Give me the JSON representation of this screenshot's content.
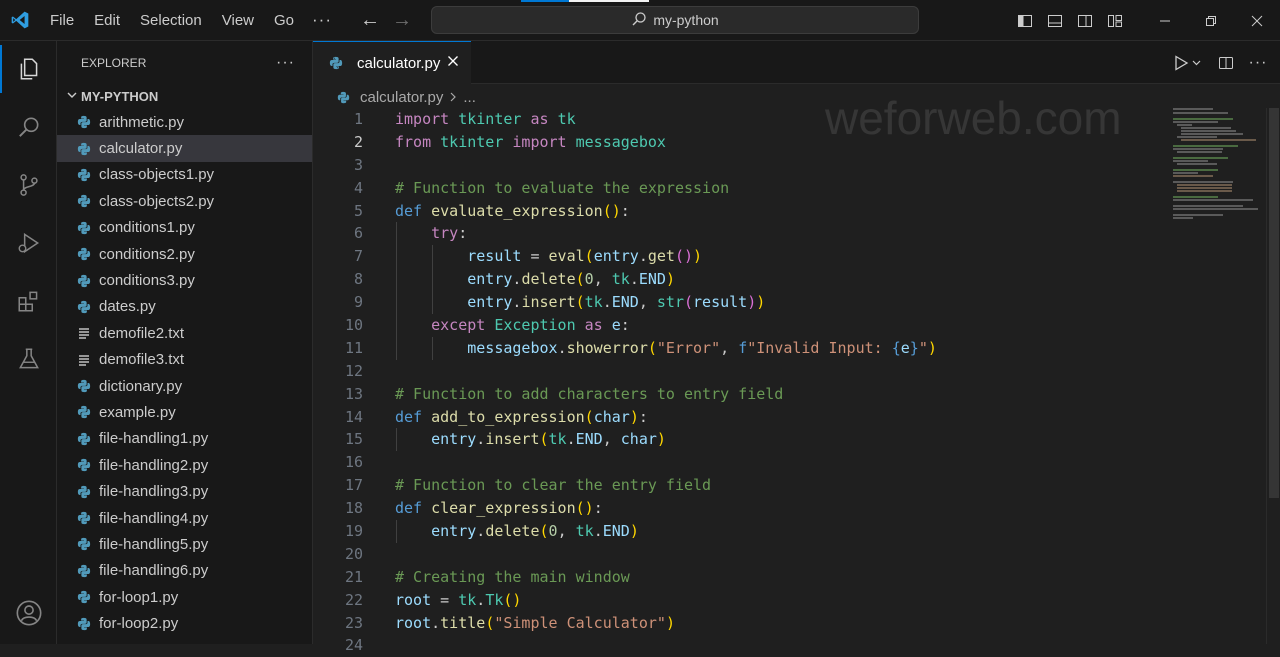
{
  "menu": [
    "File",
    "Edit",
    "Selection",
    "View",
    "Go"
  ],
  "command_center": "my-python",
  "explorer": {
    "title": "EXPLORER",
    "folder": "MY-PYTHON",
    "files": [
      {
        "name": "arithmetic.py",
        "type": "py"
      },
      {
        "name": "calculator.py",
        "type": "py",
        "selected": true
      },
      {
        "name": "class-objects1.py",
        "type": "py"
      },
      {
        "name": "class-objects2.py",
        "type": "py"
      },
      {
        "name": "conditions1.py",
        "type": "py"
      },
      {
        "name": "conditions2.py",
        "type": "py"
      },
      {
        "name": "conditions3.py",
        "type": "py"
      },
      {
        "name": "dates.py",
        "type": "py"
      },
      {
        "name": "demofile2.txt",
        "type": "txt"
      },
      {
        "name": "demofile3.txt",
        "type": "txt"
      },
      {
        "name": "dictionary.py",
        "type": "py"
      },
      {
        "name": "example.py",
        "type": "py"
      },
      {
        "name": "file-handling1.py",
        "type": "py"
      },
      {
        "name": "file-handling2.py",
        "type": "py"
      },
      {
        "name": "file-handling3.py",
        "type": "py"
      },
      {
        "name": "file-handling4.py",
        "type": "py"
      },
      {
        "name": "file-handling5.py",
        "type": "py"
      },
      {
        "name": "file-handling6.py",
        "type": "py"
      },
      {
        "name": "for-loop1.py",
        "type": "py"
      },
      {
        "name": "for-loop2.py",
        "type": "py"
      }
    ]
  },
  "editor": {
    "tab_label": "calculator.py",
    "breadcrumb_file": "calculator.py",
    "breadcrumb_more": "...",
    "watermark": "weforweb.com",
    "lines": [
      [
        [
          "kw",
          "import"
        ],
        [
          "t",
          " "
        ],
        [
          "cls",
          "tkinter"
        ],
        [
          "t",
          " "
        ],
        [
          "kw",
          "as"
        ],
        [
          "t",
          " "
        ],
        [
          "cls",
          "tk"
        ]
      ],
      [
        [
          "kw",
          "from"
        ],
        [
          "t",
          " "
        ],
        [
          "cls",
          "tkinter"
        ],
        [
          "t",
          " "
        ],
        [
          "kw",
          "import"
        ],
        [
          "t",
          " "
        ],
        [
          "cls",
          "messagebox"
        ]
      ],
      [],
      [
        [
          "com",
          "# Function to evaluate the expression"
        ]
      ],
      [
        [
          "kw2",
          "def"
        ],
        [
          "t",
          " "
        ],
        [
          "fn",
          "evaluate_expression"
        ],
        [
          "b1",
          "()"
        ],
        [
          "t",
          ":"
        ]
      ],
      [
        [
          "t",
          "    "
        ],
        [
          "kw",
          "try"
        ],
        [
          "t",
          ":"
        ]
      ],
      [
        [
          "t",
          "        "
        ],
        [
          "var",
          "result"
        ],
        [
          "t",
          " = "
        ],
        [
          "fn",
          "eval"
        ],
        [
          "b1",
          "("
        ],
        [
          "var",
          "entry"
        ],
        [
          "t",
          "."
        ],
        [
          "fn",
          "get"
        ],
        [
          "b2",
          "()"
        ],
        [
          "b1",
          ")"
        ]
      ],
      [
        [
          "t",
          "        "
        ],
        [
          "var",
          "entry"
        ],
        [
          "t",
          "."
        ],
        [
          "fn",
          "delete"
        ],
        [
          "b1",
          "("
        ],
        [
          "num",
          "0"
        ],
        [
          "t",
          ", "
        ],
        [
          "cls",
          "tk"
        ],
        [
          "t",
          "."
        ],
        [
          "var",
          "END"
        ],
        [
          "b1",
          ")"
        ]
      ],
      [
        [
          "t",
          "        "
        ],
        [
          "var",
          "entry"
        ],
        [
          "t",
          "."
        ],
        [
          "fn",
          "insert"
        ],
        [
          "b1",
          "("
        ],
        [
          "cls",
          "tk"
        ],
        [
          "t",
          "."
        ],
        [
          "var",
          "END"
        ],
        [
          "t",
          ", "
        ],
        [
          "cls",
          "str"
        ],
        [
          "b2",
          "("
        ],
        [
          "var",
          "result"
        ],
        [
          "b2",
          ")"
        ],
        [
          "b1",
          ")"
        ]
      ],
      [
        [
          "t",
          "    "
        ],
        [
          "kw",
          "except"
        ],
        [
          "t",
          " "
        ],
        [
          "cls",
          "Exception"
        ],
        [
          "t",
          " "
        ],
        [
          "kw",
          "as"
        ],
        [
          "t",
          " "
        ],
        [
          "var",
          "e"
        ],
        [
          "t",
          ":"
        ]
      ],
      [
        [
          "t",
          "        "
        ],
        [
          "var",
          "messagebox"
        ],
        [
          "t",
          "."
        ],
        [
          "fn",
          "showerror"
        ],
        [
          "b1",
          "("
        ],
        [
          "str",
          "\"Error\""
        ],
        [
          "t",
          ", "
        ],
        [
          "kw2",
          "f"
        ],
        [
          "str",
          "\"Invalid Input: "
        ],
        [
          "kw2",
          "{"
        ],
        [
          "var",
          "e"
        ],
        [
          "kw2",
          "}"
        ],
        [
          "str",
          "\""
        ],
        [
          "b1",
          ")"
        ]
      ],
      [],
      [
        [
          "com",
          "# Function to add characters to entry field"
        ]
      ],
      [
        [
          "kw2",
          "def"
        ],
        [
          "t",
          " "
        ],
        [
          "fn",
          "add_to_expression"
        ],
        [
          "b1",
          "("
        ],
        [
          "var",
          "char"
        ],
        [
          "b1",
          ")"
        ],
        [
          "t",
          ":"
        ]
      ],
      [
        [
          "t",
          "    "
        ],
        [
          "var",
          "entry"
        ],
        [
          "t",
          "."
        ],
        [
          "fn",
          "insert"
        ],
        [
          "b1",
          "("
        ],
        [
          "cls",
          "tk"
        ],
        [
          "t",
          "."
        ],
        [
          "var",
          "END"
        ],
        [
          "t",
          ", "
        ],
        [
          "var",
          "char"
        ],
        [
          "b1",
          ")"
        ]
      ],
      [],
      [
        [
          "com",
          "# Function to clear the entry field"
        ]
      ],
      [
        [
          "kw2",
          "def"
        ],
        [
          "t",
          " "
        ],
        [
          "fn",
          "clear_expression"
        ],
        [
          "b1",
          "()"
        ],
        [
          "t",
          ":"
        ]
      ],
      [
        [
          "t",
          "    "
        ],
        [
          "var",
          "entry"
        ],
        [
          "t",
          "."
        ],
        [
          "fn",
          "delete"
        ],
        [
          "b1",
          "("
        ],
        [
          "num",
          "0"
        ],
        [
          "t",
          ", "
        ],
        [
          "cls",
          "tk"
        ],
        [
          "t",
          "."
        ],
        [
          "var",
          "END"
        ],
        [
          "b1",
          ")"
        ]
      ],
      [],
      [
        [
          "com",
          "# Creating the main window"
        ]
      ],
      [
        [
          "var",
          "root"
        ],
        [
          "t",
          " = "
        ],
        [
          "cls",
          "tk"
        ],
        [
          "t",
          "."
        ],
        [
          "cls",
          "Tk"
        ],
        [
          "b1",
          "()"
        ]
      ],
      [
        [
          "var",
          "root"
        ],
        [
          "t",
          "."
        ],
        [
          "fn",
          "title"
        ],
        [
          "b1",
          "("
        ],
        [
          "str",
          "\"Simple Calculator\""
        ],
        [
          "b1",
          ")"
        ]
      ],
      []
    ]
  },
  "colors": {
    "accent": "#0078d4",
    "python_icon": "#519aba",
    "background": "#1f1f1f"
  }
}
